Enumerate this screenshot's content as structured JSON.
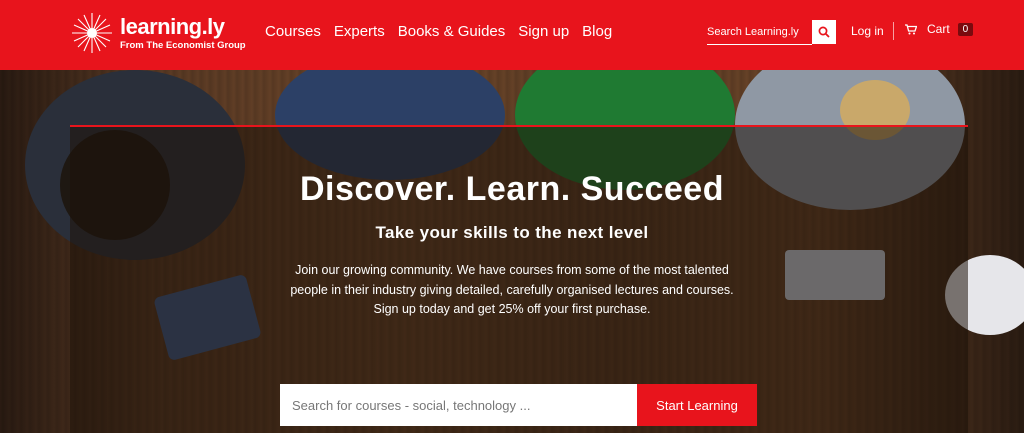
{
  "brand": {
    "name": "learning.ly",
    "tagline": "From The Economist Group",
    "color": "#e8141c"
  },
  "nav": {
    "items": [
      {
        "label": "Courses"
      },
      {
        "label": "Experts"
      },
      {
        "label": "Books & Guides"
      },
      {
        "label": "Sign up"
      },
      {
        "label": "Blog"
      }
    ]
  },
  "header_search": {
    "placeholder": "Search Learning.ly",
    "icon": "search-icon"
  },
  "account": {
    "login_label": "Log in",
    "cart_label": "Cart",
    "cart_count": "0",
    "cart_icon": "cart-icon"
  },
  "hero": {
    "title": "Discover. Learn. Succeed",
    "subtitle": "Take your skills to the next level",
    "body_lines": [
      "Join our growing community. We have courses from some of the most talented",
      "people in their industry giving detailed, carefully organised lectures and courses.",
      "Sign up today and get 25% off your first purchase."
    ],
    "search_placeholder": "Search for courses - social, technology ...",
    "cta_label": "Start Learning"
  }
}
